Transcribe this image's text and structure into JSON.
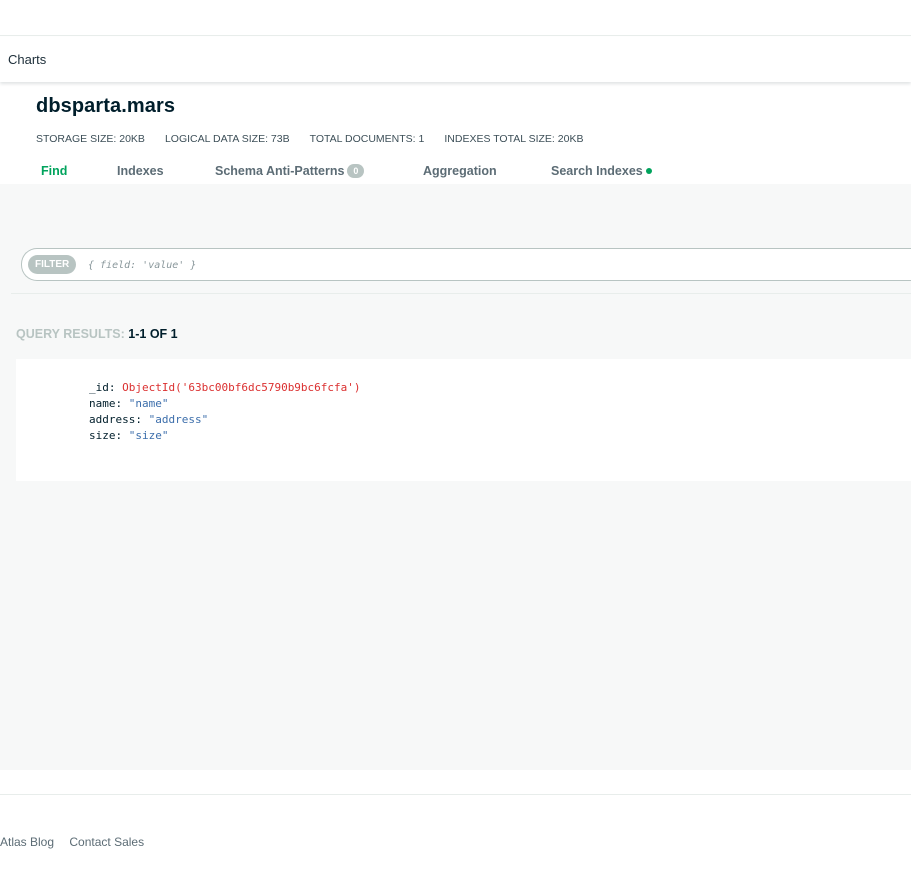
{
  "subnav": {
    "link": "Charts"
  },
  "collection": {
    "title": "dbsparta.mars",
    "stats": [
      "STORAGE SIZE: 20KB",
      "LOGICAL DATA SIZE: 73B",
      "TOTAL DOCUMENTS: 1",
      "INDEXES TOTAL SIZE: 20KB"
    ]
  },
  "tabs": {
    "find": "Find",
    "indexes": "Indexes",
    "schema": "Schema Anti-Patterns",
    "schema_badge": "0",
    "aggregation": "Aggregation",
    "search": "Search Indexes"
  },
  "filter": {
    "label": "FILTER",
    "placeholder": "{ field: 'value' }",
    "value": ""
  },
  "results": {
    "label": "QUERY RESULTS:",
    "count": "1-1 OF 1"
  },
  "document": {
    "fields": [
      {
        "key": "_id",
        "value": "ObjectId('63bc00bf6dc5790b9bc6fcfa')"
      },
      {
        "key": "name",
        "value": "\"name\""
      },
      {
        "key": "address",
        "value": "\"address\""
      },
      {
        "key": "size",
        "value": "\"size\""
      }
    ]
  },
  "footer": {
    "links": [
      "Atlas Blog",
      "Contact Sales"
    ]
  },
  "colors": {
    "accent": "#00a35c",
    "objectid": "#db3030",
    "string": "#3c6eab"
  },
  "icons": {
    "search_indexes_status": "status-dot-icon"
  }
}
